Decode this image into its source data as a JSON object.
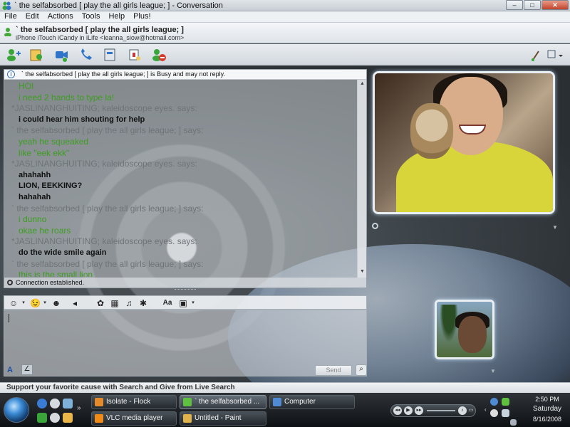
{
  "window": {
    "title": "` the selfabsorbed    [ play the all girls league; ] - Conversation",
    "minimize": "–",
    "maximize": "□",
    "close": "✕"
  },
  "menu": [
    "File",
    "Edit",
    "Actions",
    "Tools",
    "Help",
    "Plus!"
  ],
  "contact": {
    "name": "` the selfabsorbed    [ play the all girls league; ]",
    "status": "iPhone iTouch iCandy in iLife <leanna_siow@hotmail.com>"
  },
  "chat": {
    "notice": "` the selfabsorbed    [ play the all girls league; ] is Busy and may not reply.",
    "messages": [
      {
        "type": "g",
        "text": "HOI"
      },
      {
        "type": "g",
        "text": "i need 2 hands to type la!"
      },
      {
        "type": "h",
        "text": "*JASLINANGHUITING; kaleidoscope eyes. says:"
      },
      {
        "type": "b",
        "text": "i could hear him shouting for help"
      },
      {
        "type": "h",
        "text": "` the selfabsorbed    [ play the all girls league; ] says:"
      },
      {
        "type": "g",
        "text": "yeah he squeaked"
      },
      {
        "type": "g",
        "text": "like \"eek ekk\""
      },
      {
        "type": "h",
        "text": "*JASLINANGHUITING; kaleidoscope eyes. says:"
      },
      {
        "type": "b",
        "text": "ahahahh"
      },
      {
        "type": "b",
        "text": "LION, EEKKING?"
      },
      {
        "type": "b",
        "text": "hahahah"
      },
      {
        "type": "h",
        "text": "` the selfabsorbed    [ play the all girls league; ] says:"
      },
      {
        "type": "g",
        "text": "i dunno"
      },
      {
        "type": "g",
        "text": "okae he roars"
      },
      {
        "type": "h",
        "text": "*JASLINANGHUITING; kaleidoscope eyes. says:"
      },
      {
        "type": "b",
        "text": "do the wide smile again"
      },
      {
        "type": "h",
        "text": "` the selfabsorbed    [ play the all girls league; ] says:"
      },
      {
        "type": "g",
        "text": "this is the small lion"
      }
    ],
    "connection": "Connection established.",
    "send_label": "Send"
  },
  "banner": "Support your favorite cause with Search and Give from Live Search",
  "taskbar": {
    "tasks": [
      {
        "label": "Isolate - Flock",
        "icon_color": "#e58a2b"
      },
      {
        "label": "` the selfabsorbed    ...",
        "icon_color": "#5fbf3f"
      },
      {
        "label": "Computer",
        "icon_color": "#4f8ad4"
      },
      {
        "label": "VLC media player",
        "icon_color": "#f28a17"
      },
      {
        "label": "Untitled - Paint",
        "icon_color": "#e0b44a"
      }
    ],
    "clock_time": "2:50 PM",
    "clock_day": "Saturday",
    "clock_date": "8/16/2008"
  },
  "colors": {
    "incoming_text": "#3d9e1f",
    "header_text": "#6f7478",
    "outgoing_text": "#111111"
  }
}
